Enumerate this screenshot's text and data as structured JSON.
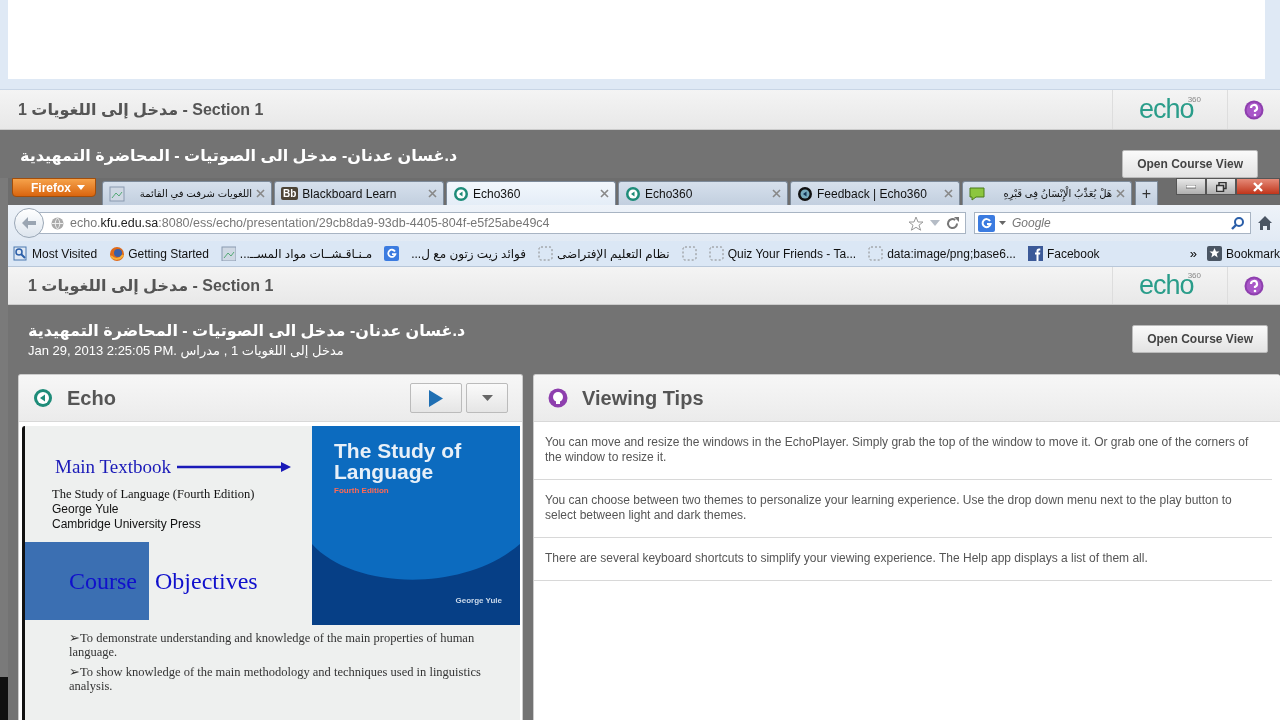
{
  "background_page": {
    "header": {
      "section_title": "مدخل إلى اللغويات 1 - Section 1",
      "logo": {
        "text": "echo",
        "superscript": "360"
      }
    },
    "presentation_title": "د.غسان عدنان- مدخل الى الصوتيات - المحاضرة التمهيدية",
    "open_course_button": "Open Course View"
  },
  "browser": {
    "menu_button": "Firefox",
    "tabs": [
      {
        "title": "اللغويات شرفت في القائمة",
        "selected": false
      },
      {
        "title": "Blackboard Learn",
        "icon_text": "Bb",
        "selected": false
      },
      {
        "title": "Echo360",
        "selected": true
      },
      {
        "title": "Echo360",
        "selected": false
      },
      {
        "title": "Feedback | Echo360",
        "selected": false
      },
      {
        "title": "هَلْ يُعَذِّبُ الْإِنْسَانُ فِى قَبْرِهِ",
        "selected": false
      }
    ],
    "new_tab_button": "+",
    "address": {
      "prefix": "echo.",
      "domain": "kfu.edu.sa",
      "rest": ":8080/ess/echo/presentation/29cb8da9-93db-4405-804f-e5f25abe49c4"
    },
    "search": {
      "placeholder": "Google"
    },
    "bookmarks": [
      {
        "label": "Most Visited"
      },
      {
        "label": "Getting Started"
      },
      {
        "label": "مـنـاقـشــات مواد المســ..."
      },
      {
        "label": "فوائد زيت زتون مع ل..."
      },
      {
        "label": "نظام التعليم الإفتراضى"
      },
      {
        "kind": "blank"
      },
      {
        "label": "Quiz Your Friends - Ta..."
      },
      {
        "label": "data:image/png;base6..."
      },
      {
        "label": "Facebook"
      }
    ],
    "overflow": "»",
    "bookmarks_menu": "Bookmark"
  },
  "page": {
    "header": {
      "section_title": "مدخل إلى اللغويات 1 - Section 1",
      "logo": {
        "text": "echo",
        "superscript": "360"
      }
    },
    "presentation_title": "د.غسان عدنان- مدخل الى الصوتيات - المحاضرة التمهيدية",
    "presentation_info": "Jan 29, 2013 2:25:05 PM. مدخل إلى اللغويات 1 , مدراس",
    "open_course_button": "Open Course View",
    "echo_panel": {
      "title": "Echo",
      "slide": {
        "main_textbook": "Main Textbook",
        "book_lines": [
          "The Study of Language (Fourth Edition)",
          "George Yule",
          "Cambridge University Press"
        ],
        "objectives_heading": [
          "Course",
          "Objectives"
        ],
        "cover": {
          "title": "The Study of Language",
          "edition": "Fourth Edition",
          "author": "George Yule"
        },
        "bullets": [
          "➢To demonstrate understanding and knowledge of the main properties of human language.",
          "➢To show knowledge of the main methodology and techniques used in linguistics analysis."
        ]
      }
    },
    "tips_panel": {
      "title": "Viewing Tips",
      "tips": [
        "You can move and resize the windows in the EchoPlayer. Simply grab the top of the window to move it. Or grab one of the corners of the window to resize it.",
        "You can choose between two themes to personalize your learning experience. Use the drop down menu next to the play button to select between light and dark themes.",
        "There are several keyboard shortcuts to simplify your viewing experience. The Help app displays a list of them all."
      ]
    }
  }
}
